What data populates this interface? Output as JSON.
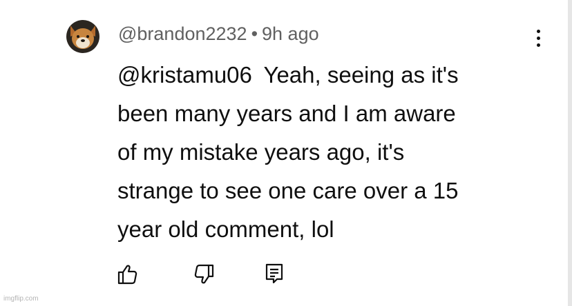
{
  "comment": {
    "author": "@brandon2232",
    "separator": "•",
    "timestamp": "9h ago",
    "mention": "@kristamu06",
    "lines": [
      "Yeah, seeing as it's",
      "been many years and I am aware",
      "of my mistake years ago, it's",
      "strange to see one care over a 15",
      "year old comment, lol"
    ],
    "avatar_icon": "dog-avatar",
    "actions": {
      "like_icon": "thumbs-up-icon",
      "dislike_icon": "thumbs-down-icon",
      "reply_icon": "comment-reply-icon",
      "menu_icon": "more-vertical-icon"
    }
  },
  "watermark": "imgflip.com",
  "colors": {
    "text": "#0f0f0f",
    "meta": "#606060",
    "watermark": "#b4b4b4"
  }
}
